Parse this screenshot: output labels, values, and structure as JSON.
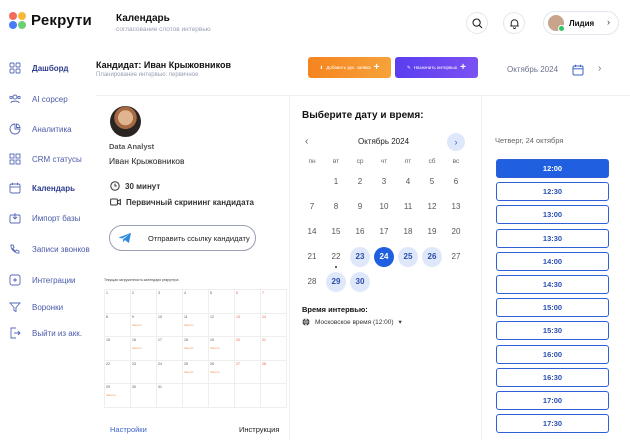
{
  "app": {
    "logo_text": "Рекрути"
  },
  "header": {
    "title": "Календарь",
    "subtitle": "согласование слотов интервью",
    "user_name": "Лидия"
  },
  "sidebar": {
    "items": [
      {
        "label": "Дашборд",
        "icon": "dashboard-icon"
      },
      {
        "label": "AI сорсер",
        "icon": "users-icon"
      },
      {
        "label": "Аналитика",
        "icon": "pie-chart-icon"
      },
      {
        "label": "CRM статусы",
        "icon": "crm-grid-icon"
      },
      {
        "label": "Календарь",
        "icon": "calendar-icon"
      },
      {
        "label": "Импорт базы",
        "icon": "import-icon"
      },
      {
        "label": "Записи звонков",
        "icon": "call-records-icon"
      },
      {
        "label": "Интеграции",
        "icon": "integrations-icon"
      },
      {
        "label": "Воронки",
        "icon": "funnel-icon"
      },
      {
        "label": "Выйти из акк.",
        "icon": "logout-icon"
      }
    ]
  },
  "main": {
    "title": "Кандидат: Иван Крыжовников",
    "subtitle": "Планирование интервью: первичное",
    "add_button": "Добавить рук. заявка",
    "schedule_button": "Назначить интервью",
    "month_label": "Октябрь 2024"
  },
  "candidate": {
    "role": "Data Analyst",
    "name": "Иван Крыжовников",
    "duration": "30 минут",
    "interview_type": "Первичный скрининг кандидата",
    "send_link": "Отправить ссылку кандидату",
    "mini_title": "Текущая загруженность календаря рекрутера",
    "settings_link": "Настройки",
    "instructions_link": "Инструкция",
    "mini_days": [
      "1",
      "2",
      "3",
      "4",
      "5",
      "6",
      "7",
      "8",
      "9",
      "10",
      "11",
      "12",
      "13",
      "14",
      "15",
      "16",
      "17",
      "18",
      "19",
      "20",
      "21",
      "22",
      "23",
      "24",
      "25",
      "26",
      "27",
      "28",
      "29",
      "30",
      "31"
    ],
    "mini_event": "Занято"
  },
  "calendar": {
    "heading": "Выберите дату и время:",
    "month": "Октябрь 2024",
    "weekdays": [
      "пн",
      "вт",
      "ср",
      "чт",
      "пт",
      "сб",
      "вс"
    ],
    "days": [
      [
        "",
        "1",
        "2",
        "3",
        "4",
        "5",
        "6"
      ],
      [
        "7",
        "8",
        "9",
        "10",
        "11",
        "12",
        "13"
      ],
      [
        "14",
        "15",
        "16",
        "17",
        "18",
        "19",
        "20"
      ],
      [
        "21",
        "22",
        "23",
        "24",
        "25",
        "26",
        "27"
      ],
      [
        "28",
        "29",
        "30",
        "",
        "",
        "",
        ""
      ]
    ],
    "available": [
      "23",
      "25",
      "26",
      "29",
      "30"
    ],
    "selected": "24",
    "today": "22",
    "tz_label": "Время интервью:",
    "tz_value": "Московское время (12:00)"
  },
  "times": {
    "date_label": "Четверг, 24 октября",
    "slots": [
      "12:00",
      "12:30",
      "13:00",
      "13:30",
      "14:00",
      "14:30",
      "15:00",
      "15:30",
      "16:00",
      "16:30",
      "17:00",
      "17:30"
    ],
    "active": "12:00"
  },
  "colors": {
    "accent": "#1f5fe0",
    "orange": "#f5841f",
    "purple": "#6a45f1"
  }
}
